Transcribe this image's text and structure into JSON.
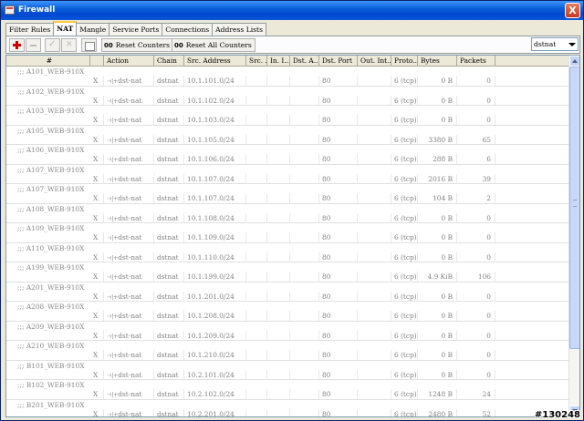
{
  "window": {
    "title": "Firewall",
    "close": "X"
  },
  "tabs": [
    {
      "label": "Filter Rules"
    },
    {
      "label": "NAT"
    },
    {
      "label": "Mangle"
    },
    {
      "label": "Service Ports"
    },
    {
      "label": "Connections"
    },
    {
      "label": "Address Lists"
    }
  ],
  "toolbar": {
    "reset_counters": "Reset Counters",
    "reset_all_counters": "Reset All Counters",
    "zero_badge": "00",
    "chain_filter": "dstnat"
  },
  "columns": [
    "#",
    "",
    "Action",
    "Chain",
    "Src. Address",
    "Src. ...",
    "In. I...",
    "Dst. A...",
    "Dst. Port",
    "Out. Int...",
    "Proto...",
    "Bytes",
    "Packets"
  ],
  "rows": [
    {
      "comment": ";;; A101_WEB-910X",
      "flag": "X",
      "action": "dst-nat",
      "chain": "dstnat",
      "src": "10.1.101.0/24",
      "dport": "80",
      "proto": "6 (tcp)",
      "bytes": "0 B",
      "packets": "0"
    },
    {
      "comment": ";;; A102_WEB-910X",
      "flag": "X",
      "action": "dst-nat",
      "chain": "dstnat",
      "src": "10.1.102.0/24",
      "dport": "80",
      "proto": "6 (tcp)",
      "bytes": "0 B",
      "packets": "0"
    },
    {
      "comment": ";;; A103_WEB-910X",
      "flag": "X",
      "action": "dst-nat",
      "chain": "dstnat",
      "src": "10.1.103.0/24",
      "dport": "80",
      "proto": "6 (tcp)",
      "bytes": "0 B",
      "packets": "0"
    },
    {
      "comment": ";;; A105_WEB-910X",
      "flag": "X",
      "action": "dst-nat",
      "chain": "dstnat",
      "src": "10.1.105.0/24",
      "dport": "80",
      "proto": "6 (tcp)",
      "bytes": "3380 B",
      "packets": "65"
    },
    {
      "comment": ";;; A106_WEB-910X",
      "flag": "X",
      "action": "dst-nat",
      "chain": "dstnat",
      "src": "10.1.106.0/24",
      "dport": "80",
      "proto": "6 (tcp)",
      "bytes": "288 B",
      "packets": "6"
    },
    {
      "comment": ";;; A107_WEB-910X",
      "flag": "X",
      "action": "dst-nat",
      "chain": "dstnat",
      "src": "10.1.107.0/24",
      "dport": "80",
      "proto": "6 (tcp)",
      "bytes": "2016 B",
      "packets": "39"
    },
    {
      "comment": ";;; A107_WEB-910X",
      "flag": "X",
      "action": "dst-nat",
      "chain": "dstnat",
      "src": "10.1.107.0/24",
      "dport": "80",
      "proto": "6 (tcp)",
      "bytes": "104 B",
      "packets": "2"
    },
    {
      "comment": ";;; A108_WEB-910X",
      "flag": "X",
      "action": "dst-nat",
      "chain": "dstnat",
      "src": "10.1.108.0/24",
      "dport": "80",
      "proto": "6 (tcp)",
      "bytes": "0 B",
      "packets": "0"
    },
    {
      "comment": ";;; A109_WEB-910X",
      "flag": "X",
      "action": "dst-nat",
      "chain": "dstnat",
      "src": "10.1.109.0/24",
      "dport": "80",
      "proto": "6 (tcp)",
      "bytes": "0 B",
      "packets": "0"
    },
    {
      "comment": ";;; A110_WEB-910X",
      "flag": "X",
      "action": "dst-nat",
      "chain": "dstnat",
      "src": "10.1.110.0/24",
      "dport": "80",
      "proto": "6 (tcp)",
      "bytes": "0 B",
      "packets": "0"
    },
    {
      "comment": ";;; A199_WEB-910X",
      "flag": "X",
      "action": "dst-nat",
      "chain": "dstnat",
      "src": "10.1.199.0/24",
      "dport": "80",
      "proto": "6 (tcp)",
      "bytes": "4.9 KiB",
      "packets": "106"
    },
    {
      "comment": ";;; A201_WEB-910X",
      "flag": "X",
      "action": "dst-nat",
      "chain": "dstnat",
      "src": "10.1.201.0/24",
      "dport": "80",
      "proto": "6 (tcp)",
      "bytes": "0 B",
      "packets": "0"
    },
    {
      "comment": ";;; A208_WEB-910X",
      "flag": "X",
      "action": "dst-nat",
      "chain": "dstnat",
      "src": "10.1.208.0/24",
      "dport": "80",
      "proto": "6 (tcp)",
      "bytes": "0 B",
      "packets": "0"
    },
    {
      "comment": ";;; A209_WEB-910X",
      "flag": "X",
      "action": "dst-nat",
      "chain": "dstnat",
      "src": "10.1.209.0/24",
      "dport": "80",
      "proto": "6 (tcp)",
      "bytes": "0 B",
      "packets": "0"
    },
    {
      "comment": ";;; A210_WEB-910X",
      "flag": "X",
      "action": "dst-nat",
      "chain": "dstnat",
      "src": "10.1.210.0/24",
      "dport": "80",
      "proto": "6 (tcp)",
      "bytes": "0 B",
      "packets": "0"
    },
    {
      "comment": ";;; B101_WEB-910X",
      "flag": "X",
      "action": "dst-nat",
      "chain": "dstnat",
      "src": "10.2.101.0/24",
      "dport": "80",
      "proto": "6 (tcp)",
      "bytes": "0 B",
      "packets": "0"
    },
    {
      "comment": ";;; B102_WEB-910X",
      "flag": "X",
      "action": "dst-nat",
      "chain": "dstnat",
      "src": "10.2.102.0/24",
      "dport": "80",
      "proto": "6 (tcp)",
      "bytes": "1248 B",
      "packets": "24"
    },
    {
      "comment": ";;; B201_WEB-910X",
      "flag": "X",
      "action": "dst-nat",
      "chain": "dstnat",
      "src": "10.2.201.0/24",
      "dport": "80",
      "proto": "6 (tcp)",
      "bytes": "2480 B",
      "packets": "52"
    }
  ],
  "watermark": "#130248"
}
